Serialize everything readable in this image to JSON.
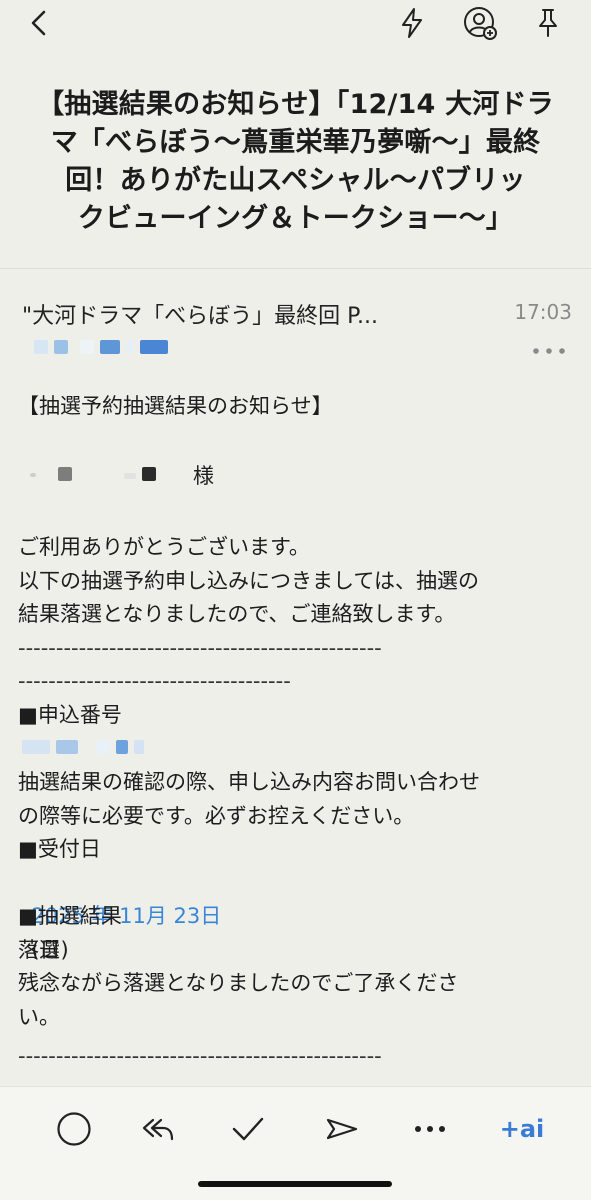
{
  "subject": {
    "lines": [
      "【抽選結果のお知らせ】「12/14 大河ドラ",
      "マ「べらぼう〜蔦重栄華乃夢噺〜」最終",
      "回！ありがた山スペシャル〜パブリッ",
      "クビューイング＆トークショー〜」"
    ]
  },
  "sender": {
    "name": "\"大河ドラマ「べらぼう」最終回 P...",
    "time": "17:03"
  },
  "body": {
    "heading": "【抽選予約抽選結果のお知らせ】",
    "salutation_suffix": "様",
    "thanks": "ご利用ありがとうございます。",
    "notice_line1": "以下の抽選予約申し込みにつきましては、抽選の",
    "notice_line2": "結果落選となりましたので、ご連絡致します。",
    "dash_line1": "------------------------------------------------",
    "dash_line2": "------------------------------------",
    "app_no_label": "■申込番号",
    "app_no_note1": "抽選結果の確認の際、申し込み内容お問い合わせ",
    "app_no_note2": "の際等に必要です。必ずお控えください。",
    "received_label": "■受付日",
    "received_date": "2025 年 11月 23日",
    "received_weekday": "(日)",
    "result_label": "■抽選結果",
    "result_value": "落選",
    "result_note1": "残念ながら落選となりましたのでご了承くださ",
    "result_note2": "い。",
    "dash_line3": "------------------------------------------------"
  },
  "toolbar": {
    "ai_label": "+ai"
  },
  "colors": {
    "background": "#efefea",
    "link": "#3a86d6",
    "ai": "#3a7bd5"
  }
}
